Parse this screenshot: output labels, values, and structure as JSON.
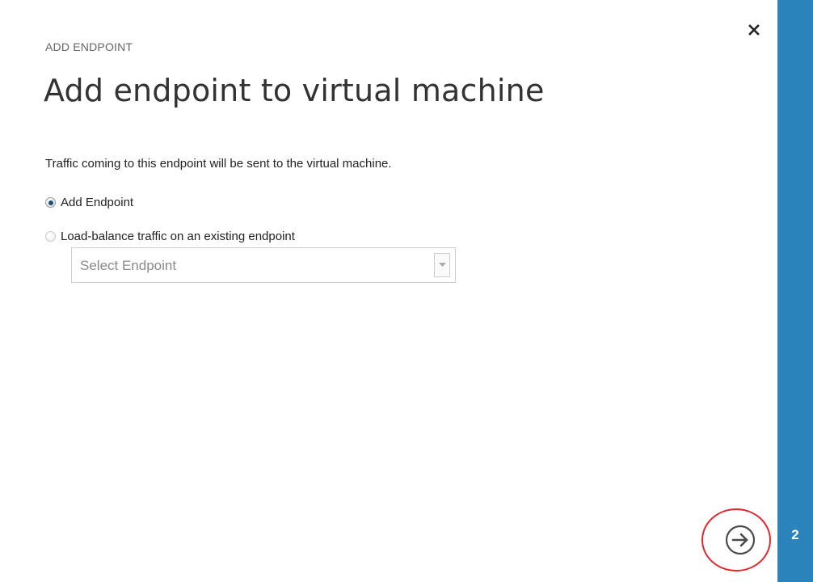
{
  "dialog": {
    "eyebrow": "ADD ENDPOINT",
    "title": "Add endpoint to virtual machine",
    "description": "Traffic coming to this endpoint will be sent to the virtual machine.",
    "options": [
      {
        "label": "Add Endpoint",
        "selected": true
      },
      {
        "label": "Load-balance traffic on an existing endpoint",
        "selected": false
      }
    ],
    "select": {
      "value": "Select Endpoint",
      "disabled": true
    },
    "close_icon": "close-icon",
    "next_icon": "arrow-right-circle-icon",
    "step_number": "2"
  },
  "colors": {
    "side_rail": "#2a83ba",
    "highlight_ring": "#e2262c",
    "radio_selected": "#1f4e79"
  }
}
